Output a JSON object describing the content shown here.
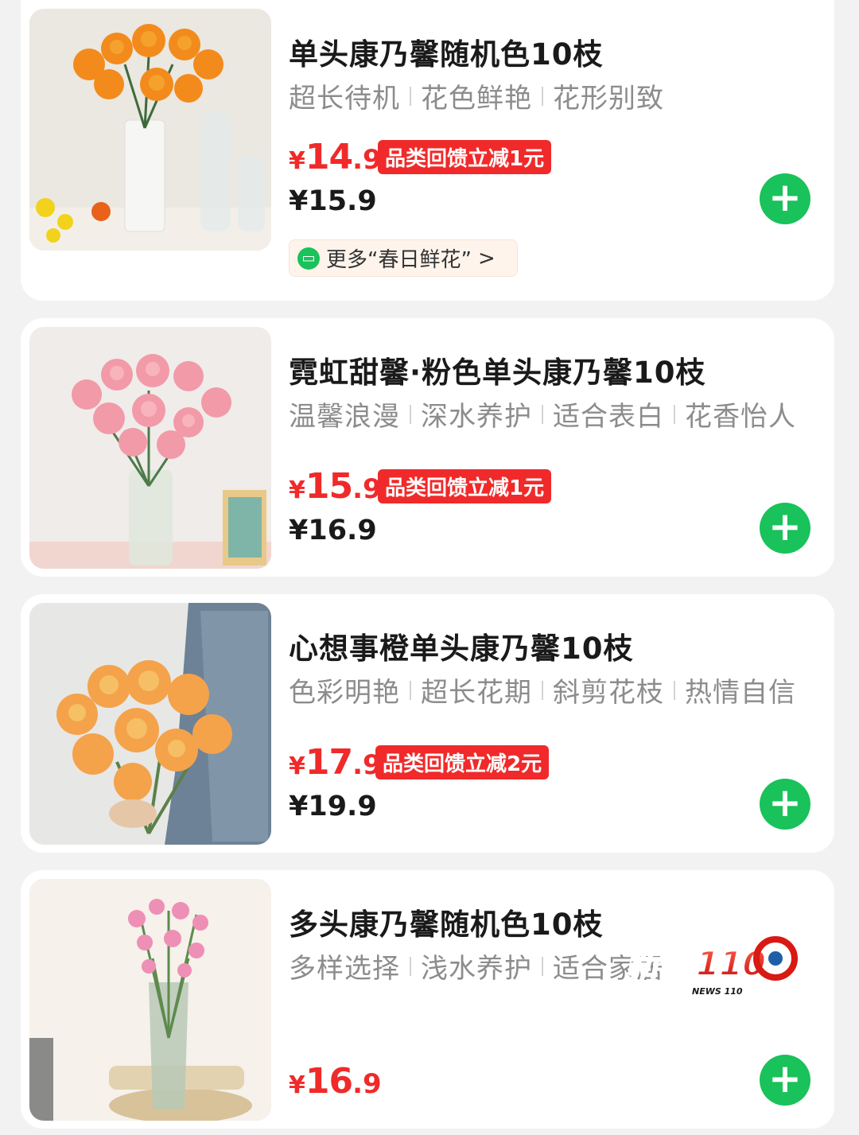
{
  "products": [
    {
      "title": "单头康乃馨随机色10枝",
      "tags": [
        "超长待机",
        "花色鲜艳",
        "花形别致"
      ],
      "price": {
        "currency": "¥",
        "int": "14",
        "dec": ".9"
      },
      "badge": "品类回馈立减1元",
      "old_price": "¥15.9",
      "more_label": "更多“春日鲜花”",
      "more_arrow": ">"
    },
    {
      "title": "霓虹甜馨·粉色单头康乃馨10枝",
      "tags": [
        "温馨浪漫",
        "深水养护",
        "适合表白",
        "花香怡人"
      ],
      "price": {
        "currency": "¥",
        "int": "15",
        "dec": ".9"
      },
      "badge": "品类回馈立减1元",
      "old_price": "¥16.9"
    },
    {
      "title": "心想事橙单头康乃馨10枝",
      "tags": [
        "色彩明艳",
        "超长花期",
        "斜剪花枝",
        "热情自信"
      ],
      "price": {
        "currency": "¥",
        "int": "17",
        "dec": ".9"
      },
      "badge": "品类回馈立减2元",
      "old_price": "¥19.9"
    },
    {
      "title": "多头康乃馨随机色10枝",
      "tags": [
        "多样选择",
        "浅水养护",
        "适合家居"
      ],
      "price": {
        "currency": "¥",
        "int": "16",
        "dec": ".9"
      }
    }
  ],
  "add_button_icon": "plus-icon",
  "add_symbol": "+",
  "watermark": {
    "text": "新闻110",
    "subtext": "NEWS 110"
  },
  "colors": {
    "accent_red": "#f02a2a",
    "add_green": "#19c25a"
  }
}
